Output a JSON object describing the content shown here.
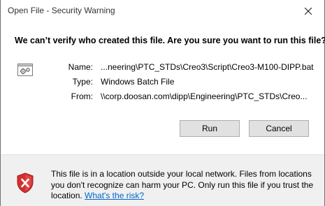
{
  "window": {
    "title": "Open File - Security Warning"
  },
  "headline": "We can’t verify who created this file. Are you sure you want to run this file?",
  "file_info": {
    "icon": "batch-file-gear-icon",
    "name_label": "Name:",
    "name_value": "...neering\\PTC_STDs\\Creo3\\Script\\Creo3-M100-DIPP.bat",
    "type_label": "Type:",
    "type_value": "Windows Batch File",
    "from_label": "From:",
    "from_value": "\\\\corp.doosan.com\\dipp\\Engineering\\PTC_STDs\\Creo..."
  },
  "buttons": {
    "run_label": "Run",
    "cancel_label": "Cancel"
  },
  "warning": {
    "icon": "shield-error-icon",
    "text": "This file is in a location outside your local network. Files from locations you don't recognize can harm your PC. Only run this file if you trust the location.",
    "link_text": "What's the risk?"
  },
  "colors": {
    "link": "#0066cc",
    "shield_red": "#d32f2f",
    "footer_bg": "#f0f0f0",
    "button_bg": "#e1e1e1"
  }
}
